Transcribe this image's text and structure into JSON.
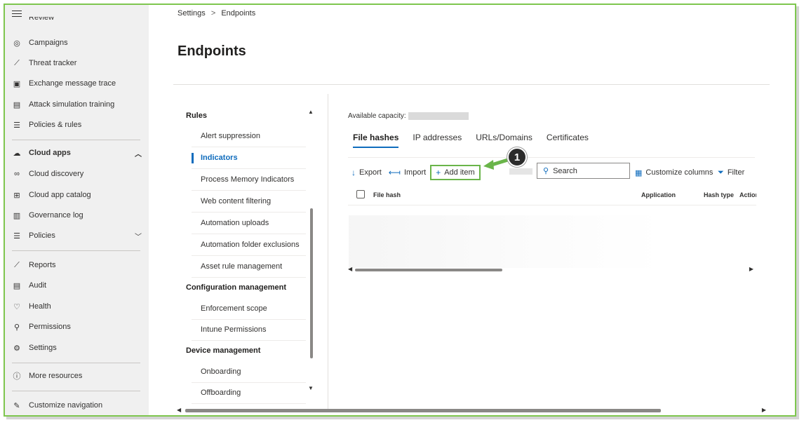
{
  "sidebar": {
    "cut_item": "Review",
    "items": [
      {
        "label": "Campaigns",
        "icon": "target-icon"
      },
      {
        "label": "Threat tracker",
        "icon": "chart-icon"
      },
      {
        "label": "Exchange message trace",
        "icon": "exchange-icon"
      },
      {
        "label": "Attack simulation training",
        "icon": "training-icon"
      },
      {
        "label": "Policies & rules",
        "icon": "sliders-icon"
      },
      {
        "label": "Cloud apps",
        "icon": "cloud-icon"
      },
      {
        "label": "Cloud discovery",
        "icon": "binoculars-icon"
      },
      {
        "label": "Cloud app catalog",
        "icon": "catalog-icon"
      },
      {
        "label": "Governance log",
        "icon": "log-icon"
      },
      {
        "label": "Policies",
        "icon": "sliders-icon"
      },
      {
        "label": "Reports",
        "icon": "chart-icon"
      },
      {
        "label": "Audit",
        "icon": "audit-icon"
      },
      {
        "label": "Health",
        "icon": "heart-icon"
      },
      {
        "label": "Permissions",
        "icon": "key-icon"
      },
      {
        "label": "Settings",
        "icon": "gear-icon"
      },
      {
        "label": "More resources",
        "icon": "info-icon"
      },
      {
        "label": "Customize navigation",
        "icon": "pencil-icon"
      }
    ]
  },
  "breadcrumb": {
    "root": "Settings",
    "separator": ">",
    "current": "Endpoints"
  },
  "page": {
    "title": "Endpoints"
  },
  "settings_list": {
    "groups": [
      {
        "label": "Rules"
      },
      {
        "label": "Configuration management"
      },
      {
        "label": "Device management"
      }
    ],
    "items": [
      {
        "label": "Alert suppression"
      },
      {
        "label": "Indicators"
      },
      {
        "label": "Process Memory Indicators"
      },
      {
        "label": "Web content filtering"
      },
      {
        "label": "Automation uploads"
      },
      {
        "label": "Automation folder exclusions"
      },
      {
        "label": "Asset rule management"
      },
      {
        "label": "Enforcement scope"
      },
      {
        "label": "Intune Permissions"
      },
      {
        "label": "Onboarding"
      },
      {
        "label": "Offboarding"
      }
    ]
  },
  "panel": {
    "capacity_label": "Available capacity:",
    "tabs": [
      {
        "label": "File hashes"
      },
      {
        "label": "IP addresses"
      },
      {
        "label": "URLs/Domains"
      },
      {
        "label": "Certificates"
      }
    ],
    "toolbar": {
      "export": "Export",
      "import": "Import",
      "add_item": "Add item",
      "search_placeholder": "Search",
      "customize_columns": "Customize columns",
      "filter": "Filter"
    },
    "table": {
      "columns": [
        "File hash",
        "Application",
        "Hash type",
        "Action"
      ]
    },
    "callout_number": "1"
  },
  "colors": {
    "accent": "#0f6cbd",
    "highlight": "#6ab54a",
    "frame": "#7ec64e"
  }
}
